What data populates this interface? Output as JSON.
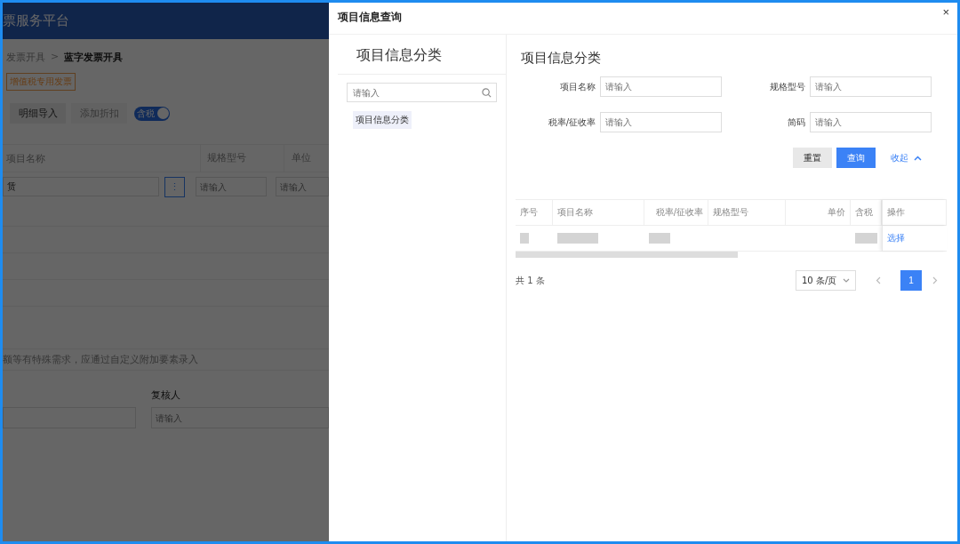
{
  "background_page": {
    "header_title": "票服务平台",
    "breadcrumb": [
      "发票开具",
      "蓝字发票开具"
    ],
    "breadcrumb_separator": ">",
    "invoice_tag": "增值税专用发票",
    "buttons": [
      {
        "label": "明细导入",
        "disabled": false
      },
      {
        "label": "添加折扣",
        "disabled": true
      }
    ],
    "tax_switch": {
      "label": "含税",
      "on": true
    },
    "table": {
      "columns": [
        "项目名称",
        "规格型号",
        "单位"
      ],
      "row": {
        "item_name": "赁",
        "more_button": "⋮",
        "inputs": [
          {
            "placeholder": "请输入"
          },
          {
            "placeholder": "请输入"
          }
        ]
      }
    },
    "notice": "额等有特殊需求，应通过自定义附加要素录入",
    "reviewer": {
      "label": "复核人",
      "placeholder": "请输入"
    }
  },
  "modal": {
    "title": "项目信息查询",
    "close": "×",
    "category_panel": {
      "heading": "项目信息分类",
      "search": {
        "placeholder": "请输入"
      },
      "tree": [
        {
          "label": "项目信息分类",
          "selected": true
        }
      ]
    },
    "query": {
      "heading": "项目信息分类",
      "fields": [
        {
          "label": "项目名称",
          "placeholder": "请输入"
        },
        {
          "label": "规格型号",
          "placeholder": "请输入"
        },
        {
          "label": "税率/征收率",
          "placeholder": "请输入"
        },
        {
          "label": "简码",
          "placeholder": "请输入"
        }
      ],
      "buttons": [
        {
          "label": "重置",
          "kind": "default"
        },
        {
          "label": "查询",
          "kind": "primary"
        }
      ],
      "collapse_link": "收起",
      "table": {
        "columns": [
          {
            "label": "序号"
          },
          {
            "label": "项目名称"
          },
          {
            "label": "税率/征收率"
          },
          {
            "label": "规格型号"
          },
          {
            "label": "单价"
          },
          {
            "label": "含税"
          },
          {
            "label": "操作"
          }
        ],
        "rows": [
          {
            "action": "选择"
          }
        ]
      },
      "pagination": {
        "total": "共 1 条",
        "page_size": "10 条/页",
        "pages": [
          {
            "label": "1",
            "selected": true
          }
        ]
      }
    }
  }
}
